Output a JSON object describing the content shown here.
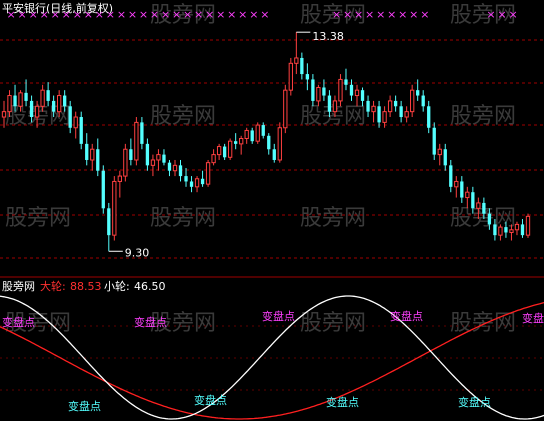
{
  "upper_panel": {
    "title": "平安银行(日线,前复权)",
    "high_label": "13.38",
    "low_label": "9.30"
  },
  "lower_panel": {
    "site_label": "股旁网",
    "indicator_1_name": "大轮:",
    "indicator_1_value": "88.53",
    "indicator_2_name": "小轮:",
    "indicator_2_value": "46.50",
    "turn_point_label": "变盘点"
  },
  "watermark_text": "股旁网",
  "colors": {
    "background": "#000000",
    "up_candle": "#ff4040",
    "down_candle": "#54ffff",
    "title": "#ffffff",
    "grid": "#a00000",
    "big_wave": "#ff2020",
    "small_wave": "#ffffff",
    "turn_label": "#ff40ff",
    "turn_label_2": "#54ffff",
    "signal_marker": "#ff40ff",
    "indicator_1_value": "#ff3030",
    "indicator_2_value": "#ffffff"
  },
  "chart_data": [
    {
      "type": "candlestick",
      "title": "平安银行(日线,前复权)",
      "annotations": [
        {
          "text": "13.38",
          "value": 13.38,
          "kind": "high"
        },
        {
          "text": "9.30",
          "value": 9.3,
          "kind": "low"
        }
      ],
      "ylim": [
        9.1,
        13.7
      ],
      "ohlc": [
        [
          11.8,
          12.1,
          11.6,
          11.9
        ],
        [
          11.9,
          12.3,
          11.8,
          12.2
        ],
        [
          12.2,
          12.4,
          11.9,
          12.0
        ],
        [
          12.0,
          12.3,
          11.9,
          12.25
        ],
        [
          12.25,
          12.5,
          12.0,
          12.1
        ],
        [
          12.1,
          12.2,
          11.7,
          11.8
        ],
        [
          11.8,
          12.1,
          11.6,
          12.0
        ],
        [
          12.0,
          12.4,
          11.9,
          12.3
        ],
        [
          12.3,
          12.45,
          12.0,
          12.1
        ],
        [
          12.1,
          12.2,
          11.8,
          11.9
        ],
        [
          11.9,
          12.3,
          11.8,
          12.2
        ],
        [
          12.2,
          12.3,
          11.9,
          12.0
        ],
        [
          12.0,
          12.1,
          11.5,
          11.6
        ],
        [
          11.6,
          11.9,
          11.4,
          11.8
        ],
        [
          11.8,
          11.9,
          11.2,
          11.3
        ],
        [
          11.3,
          11.5,
          10.9,
          11.0
        ],
        [
          11.0,
          11.3,
          10.8,
          11.2
        ],
        [
          11.2,
          11.4,
          10.7,
          10.8
        ],
        [
          10.8,
          10.9,
          10.0,
          10.1
        ],
        [
          10.1,
          10.2,
          9.3,
          9.6
        ],
        [
          9.6,
          10.7,
          9.5,
          10.6
        ],
        [
          10.6,
          10.8,
          10.3,
          10.7
        ],
        [
          10.7,
          11.3,
          10.6,
          11.2
        ],
        [
          11.2,
          11.4,
          10.9,
          11.0
        ],
        [
          11.0,
          11.8,
          10.9,
          11.7
        ],
        [
          11.7,
          11.8,
          11.2,
          11.3
        ],
        [
          11.3,
          11.4,
          10.8,
          10.9
        ],
        [
          10.9,
          11.1,
          10.7,
          11.0
        ],
        [
          11.0,
          11.2,
          10.8,
          11.1
        ],
        [
          11.1,
          11.2,
          10.9,
          10.95
        ],
        [
          10.95,
          11.0,
          10.7,
          10.8
        ],
        [
          10.8,
          11.0,
          10.7,
          10.9
        ],
        [
          10.9,
          11.0,
          10.6,
          10.7
        ],
        [
          10.7,
          10.85,
          10.5,
          10.6
        ],
        [
          10.6,
          10.7,
          10.4,
          10.5
        ],
        [
          10.5,
          10.7,
          10.4,
          10.65
        ],
        [
          10.65,
          10.8,
          10.5,
          10.55
        ],
        [
          10.55,
          11.0,
          10.5,
          10.95
        ],
        [
          10.95,
          11.2,
          10.9,
          11.1
        ],
        [
          11.1,
          11.3,
          11.0,
          11.25
        ],
        [
          11.25,
          11.3,
          11.0,
          11.05
        ],
        [
          11.05,
          11.4,
          11.0,
          11.35
        ],
        [
          11.35,
          11.5,
          11.2,
          11.3
        ],
        [
          11.3,
          11.45,
          11.1,
          11.4
        ],
        [
          11.4,
          11.6,
          11.3,
          11.55
        ],
        [
          11.55,
          11.6,
          11.3,
          11.35
        ],
        [
          11.35,
          11.7,
          11.3,
          11.65
        ],
        [
          11.65,
          11.7,
          11.4,
          11.45
        ],
        [
          11.45,
          11.5,
          11.1,
          11.2
        ],
        [
          11.2,
          11.3,
          10.95,
          11.0
        ],
        [
          11.0,
          11.7,
          10.95,
          11.6
        ],
        [
          11.6,
          12.4,
          11.5,
          12.3
        ],
        [
          12.3,
          12.9,
          12.2,
          12.8
        ],
        [
          12.8,
          13.38,
          12.6,
          12.9
        ],
        [
          12.9,
          13.0,
          12.5,
          12.6
        ],
        [
          12.6,
          12.8,
          12.3,
          12.5
        ],
        [
          12.5,
          12.6,
          12.0,
          12.1
        ],
        [
          12.1,
          12.4,
          12.0,
          12.35
        ],
        [
          12.35,
          12.5,
          12.1,
          12.2
        ],
        [
          12.2,
          12.3,
          11.8,
          11.9
        ],
        [
          11.9,
          12.2,
          11.8,
          12.1
        ],
        [
          12.1,
          12.6,
          12.0,
          12.5
        ],
        [
          12.5,
          12.7,
          12.3,
          12.4
        ],
        [
          12.4,
          12.5,
          12.1,
          12.2
        ],
        [
          12.2,
          12.4,
          12.0,
          12.3
        ],
        [
          12.3,
          12.35,
          12.0,
          12.1
        ],
        [
          12.1,
          12.2,
          11.8,
          11.9
        ],
        [
          11.9,
          12.1,
          11.7,
          12.0
        ],
        [
          12.0,
          12.1,
          11.6,
          11.7
        ],
        [
          11.7,
          12.0,
          11.6,
          11.9
        ],
        [
          11.9,
          12.2,
          11.8,
          12.1
        ],
        [
          12.1,
          12.2,
          11.9,
          12.0
        ],
        [
          12.0,
          12.1,
          11.7,
          11.8
        ],
        [
          11.8,
          12.0,
          11.7,
          11.9
        ],
        [
          11.9,
          12.4,
          11.8,
          12.3
        ],
        [
          12.3,
          12.5,
          12.1,
          12.2
        ],
        [
          12.2,
          12.3,
          11.9,
          12.0
        ],
        [
          12.0,
          12.1,
          11.5,
          11.6
        ],
        [
          11.6,
          11.7,
          11.0,
          11.1
        ],
        [
          11.1,
          11.3,
          10.9,
          11.2
        ],
        [
          11.2,
          11.3,
          10.8,
          10.9
        ],
        [
          10.9,
          11.0,
          10.4,
          10.5
        ],
        [
          10.5,
          10.7,
          10.3,
          10.6
        ],
        [
          10.6,
          10.7,
          10.2,
          10.3
        ],
        [
          10.3,
          10.5,
          10.1,
          10.4
        ],
        [
          10.4,
          10.5,
          10.0,
          10.1
        ],
        [
          10.1,
          10.3,
          9.9,
          10.2
        ],
        [
          10.2,
          10.3,
          9.9,
          10.0
        ],
        [
          10.0,
          10.1,
          9.7,
          9.8
        ],
        [
          9.8,
          9.9,
          9.5,
          9.6
        ],
        [
          9.6,
          9.8,
          9.5,
          9.75
        ],
        [
          9.75,
          9.85,
          9.55,
          9.65
        ],
        [
          9.65,
          9.8,
          9.5,
          9.7
        ],
        [
          9.7,
          9.85,
          9.6,
          9.8
        ],
        [
          9.8,
          9.9,
          9.55,
          9.6
        ],
        [
          9.6,
          10.0,
          9.55,
          9.95
        ]
      ]
    },
    {
      "type": "line",
      "series": [
        {
          "name": "大轮:",
          "color": "#ff2020",
          "period_bars": 130,
          "phase_deg": 150,
          "last_value": 88.53
        },
        {
          "name": "小轮:",
          "color": "#ffffff",
          "period_bars": 64,
          "phase_deg": 95,
          "last_value": 46.5
        }
      ],
      "ylim": [
        0,
        100
      ],
      "point_annotations": [
        {
          "text": "变盘点",
          "color": "#ff40ff",
          "value": 80
        },
        {
          "text": "变盘点",
          "color": "#ff40ff",
          "value": 80
        },
        {
          "text": "变盘点",
          "color": "#ff40ff",
          "value": 80
        },
        {
          "text": "变盘点",
          "color": "#ff40ff",
          "value": 80
        },
        {
          "text": "变盘点",
          "color": "#ff40ff",
          "value": 80
        },
        {
          "text": "变盘点",
          "color": "#54ffff",
          "value": 20
        },
        {
          "text": "变盘点",
          "color": "#54ffff",
          "value": 20
        },
        {
          "text": "变盘点",
          "color": "#54ffff",
          "value": 20
        },
        {
          "text": "变盘点",
          "color": "#54ffff",
          "value": 20
        }
      ]
    }
  ]
}
